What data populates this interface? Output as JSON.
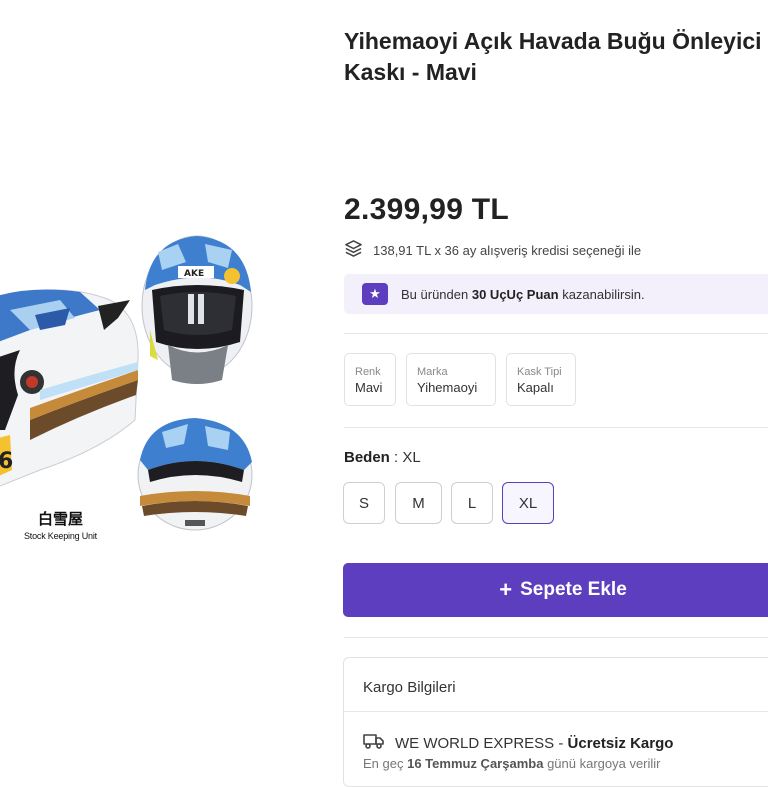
{
  "product": {
    "title_line1": "Yihemaoyi Açık Havada Buğu Önleyici T",
    "title_line2": "Kaskı - Mavi",
    "price": "2.399,99 TL",
    "credit_text": "138,91 TL x 36 ay alışveriş kredisi seçeneği ile",
    "image": {
      "sku_title": "白雪屋",
      "sku_caption": "Stock Keeping Unit",
      "helmet_text": "AKE"
    }
  },
  "points": {
    "prefix": "Bu üründen",
    "amount": "30 UçUç Puan",
    "suffix": "kazanabilirsin."
  },
  "attributes": [
    {
      "key": "Renk",
      "value": "Mavi"
    },
    {
      "key": "Marka",
      "value": "Yihemaoyi"
    },
    {
      "key": "Kask Tipi",
      "value": "Kapalı"
    }
  ],
  "size": {
    "label": "Beden",
    "separator": ":",
    "selected": "XL",
    "options": [
      "S",
      "M",
      "L",
      "XL"
    ]
  },
  "cart": {
    "label": "Sepete Ekle"
  },
  "shipping": {
    "title": "Kargo Bilgileri",
    "carrier": "WE WORLD EXPRESS",
    "dash": "-",
    "free_label": "Ücretsiz Kargo",
    "date_prefix": "En geç",
    "date": "16 Temmuz Çarşamba",
    "date_suffix": "günü kargoya verilir"
  },
  "colors": {
    "accent": "#5c3ebf",
    "points_bg": "#f3f0fb"
  },
  "icons": {
    "credit": "layers-icon",
    "points": "star-icon",
    "cart": "plus-icon",
    "shipping": "truck-icon"
  }
}
